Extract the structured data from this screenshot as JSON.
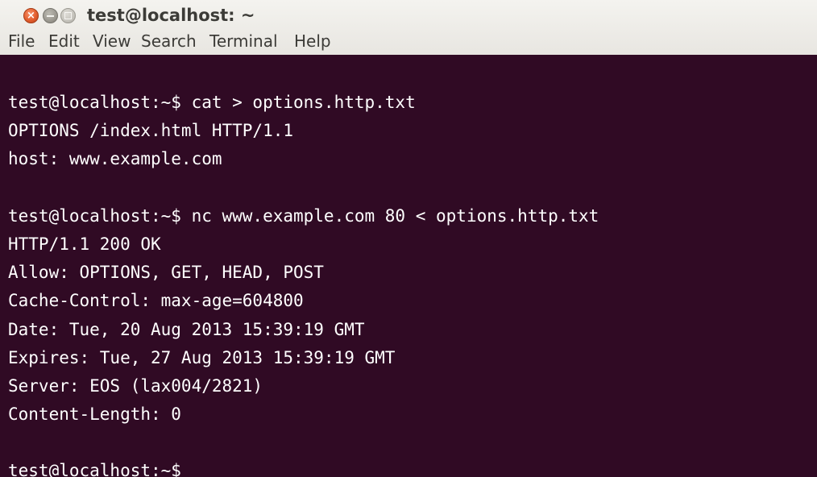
{
  "window": {
    "title": "test@localhost: ~",
    "buttons": {
      "close_glyph": "×"
    }
  },
  "menubar": {
    "items": [
      "File",
      "Edit",
      "View",
      "Search",
      "Terminal",
      "Help"
    ]
  },
  "terminal": {
    "background": "#300a24",
    "foreground": "#ffffff",
    "lines": [
      "test@localhost:~$ cat > options.http.txt",
      "OPTIONS /index.html HTTP/1.1",
      "host: www.example.com",
      "",
      "test@localhost:~$ nc www.example.com 80 < options.http.txt",
      "HTTP/1.1 200 OK",
      "Allow: OPTIONS, GET, HEAD, POST",
      "Cache-Control: max-age=604800",
      "Date: Tue, 20 Aug 2013 15:39:19 GMT",
      "Expires: Tue, 27 Aug 2013 15:39:19 GMT",
      "Server: EOS (lax004/2821)",
      "Content-Length: 0",
      "",
      "test@localhost:~$"
    ]
  },
  "colors": {
    "close_button": "#e35e2e",
    "titlebar": "#f0efeb",
    "terminal_bg": "#300a24"
  }
}
